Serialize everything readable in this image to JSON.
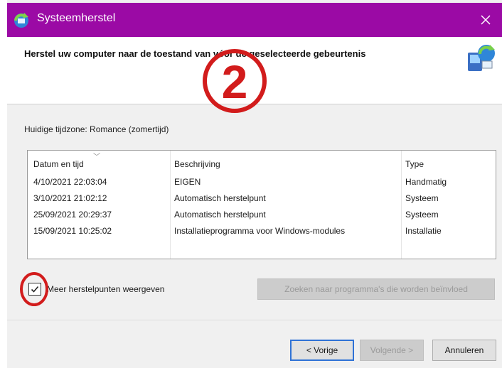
{
  "window": {
    "title": "Systeemherstel",
    "close_label": "✕",
    "accent_color": "#9b0aa5"
  },
  "header": {
    "heading": "Herstel uw computer naar de toestand van vóór de geselecteerde gebeurtenis",
    "annotation_number": "2"
  },
  "timezone_text": "Huidige tijdzone: Romance (zomertijd)",
  "table": {
    "columns": [
      "Datum en tijd",
      "Beschrijving",
      "Type"
    ],
    "rows": [
      [
        "4/10/2021 22:03:04",
        "EIGEN",
        "Handmatig"
      ],
      [
        "3/10/2021 21:02:12",
        "Automatisch herstelpunt",
        "Systeem"
      ],
      [
        "25/09/2021 20:29:37",
        "Automatisch herstelpunt",
        "Systeem"
      ],
      [
        "15/09/2021 10:25:02",
        "Installatieprogramma voor Windows-modules",
        "Installatie"
      ]
    ]
  },
  "more_points": {
    "label": "Meer herstelpunten weergeven",
    "checked": true
  },
  "buttons": {
    "scan": "Zoeken naar programma's die worden beïnvloed",
    "back": "< Vorige",
    "next": "Volgende >",
    "cancel": "Annuleren"
  },
  "icons": {
    "title": "system-restore-icon",
    "header": "restore-computer-icon",
    "check": "checkmark-icon",
    "close": "close-icon"
  },
  "annotation_color": "#d21c1c"
}
